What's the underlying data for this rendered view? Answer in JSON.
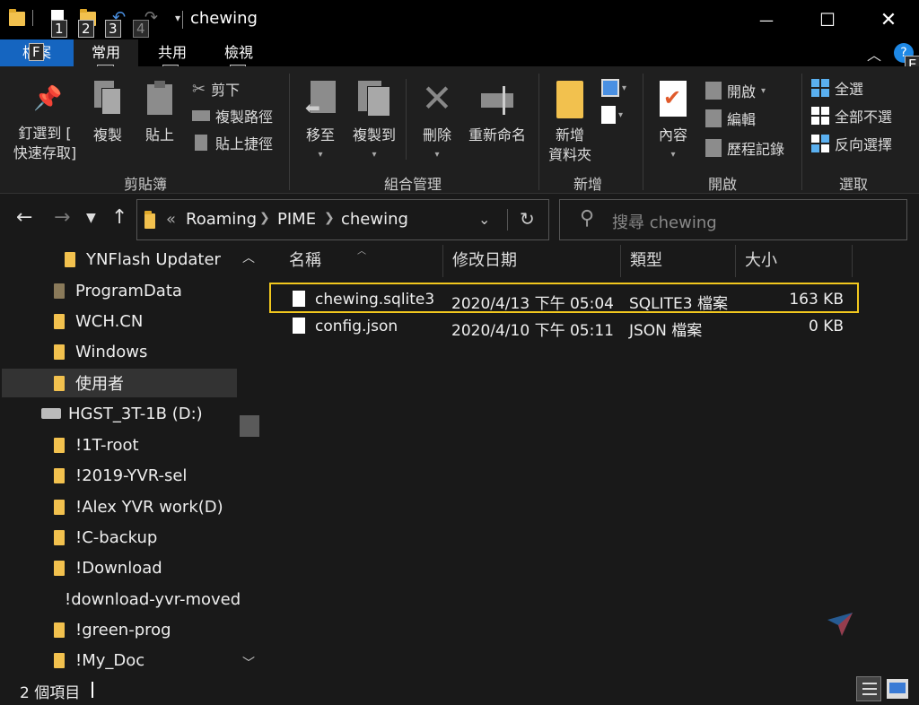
{
  "title": {
    "window_title": "chewing",
    "keytips": [
      "1",
      "2",
      "3",
      "4"
    ],
    "minimize_glyph": "—",
    "maximize_glyph": "☐",
    "close_glyph": "✕"
  },
  "tabs": {
    "file_label": "檔案",
    "file_keytip": "F",
    "home_label": "常用",
    "home_keytip": "H",
    "share_label": "共用",
    "share_keytip": "S",
    "view_label": "檢視",
    "view_keytip": "V",
    "help_keytip": "E"
  },
  "ribbon": {
    "clipboard": {
      "pin_label_1": "釘選到 [",
      "pin_label_2": "快速存取]",
      "copy": "複製",
      "paste": "貼上",
      "cut": "剪下",
      "copy_path": "複製路徑",
      "paste_shortcut": "貼上捷徑",
      "group": "剪貼簿"
    },
    "organize": {
      "move_to": "移至",
      "copy_to": "複製到",
      "delete": "刪除",
      "rename": "重新命名",
      "group": "組合管理"
    },
    "new": {
      "new_folder_1": "新增",
      "new_folder_2": "資料夾",
      "group": "新增"
    },
    "open": {
      "properties": "內容",
      "open": "開啟",
      "edit": "編輯",
      "history": "歷程記錄",
      "group": "開啟"
    },
    "select": {
      "select_all": "全選",
      "select_none": "全部不選",
      "invert": "反向選擇",
      "group": "選取"
    }
  },
  "address": {
    "overflow": "«",
    "crumbs": [
      "Roaming",
      "PIME",
      "chewing"
    ],
    "search_placeholder": "搜尋 chewing"
  },
  "navpane": {
    "items": [
      {
        "label": "YNFlash Updater"
      },
      {
        "label": "ProgramData"
      },
      {
        "label": "WCH.CN"
      },
      {
        "label": "Windows"
      },
      {
        "label": "使用者"
      },
      {
        "label": "HGST_3T-1B (D:)"
      },
      {
        "label": "!1T-root"
      },
      {
        "label": "!2019-YVR-sel"
      },
      {
        "label": "!Alex YVR work(D)"
      },
      {
        "label": "!C-backup"
      },
      {
        "label": "!Download"
      },
      {
        "label": "!download-yvr-moved"
      },
      {
        "label": "!green-prog"
      },
      {
        "label": "!My_Doc"
      }
    ]
  },
  "filelist": {
    "columns": [
      "名稱",
      "修改日期",
      "類型",
      "大小"
    ],
    "rows": [
      {
        "name": "chewing.sqlite3",
        "date": "2020/4/13 下午 05:04",
        "type": "SQLITE3 檔案",
        "size": "163 KB"
      },
      {
        "name": "config.json",
        "date": "2020/4/10 下午 05:11",
        "type": "JSON 檔案",
        "size": "0 KB"
      }
    ]
  },
  "status": {
    "item_count": "2 個項目"
  }
}
